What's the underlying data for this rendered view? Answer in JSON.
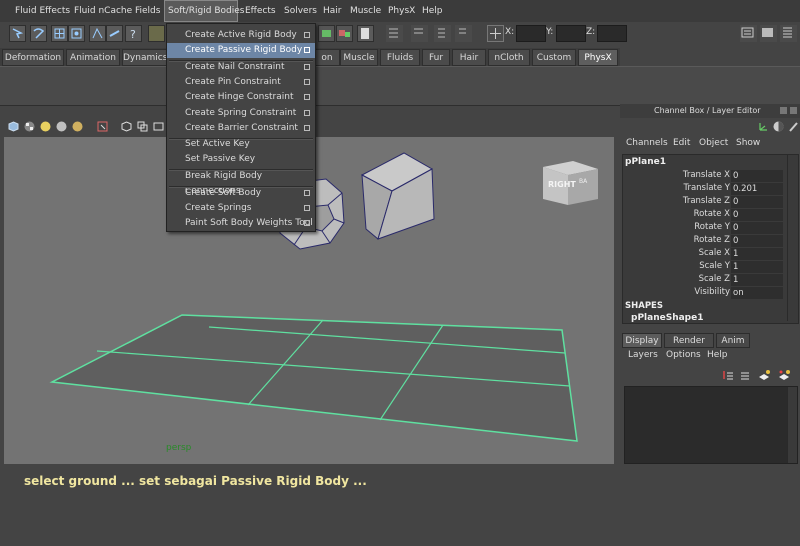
{
  "menubar": {
    "items": [
      "Fluid Effects",
      "Fluid nCache",
      "Fields",
      "Soft/Rigid Bodies",
      "Effects",
      "Solvers",
      "Hair",
      "Muscle",
      "PhysX",
      "Help"
    ]
  },
  "toolbar": {
    "x_label": "X:",
    "y_label": "Y:",
    "z_label": "Z:"
  },
  "shelf": {
    "tabs": [
      "Deformation",
      "Animation",
      "Dynamics",
      "",
      "on",
      "Muscle",
      "Fluids",
      "Fur",
      "Hair",
      "nCloth",
      "Custom",
      "PhysX"
    ],
    "selected": "PhysX"
  },
  "dropdown": {
    "items": [
      {
        "label": "Create Active Rigid Body",
        "option": true
      },
      {
        "label": "Create Passive Rigid Body",
        "option": true,
        "highlighted": true
      },
      {
        "label": "Create Nail Constraint",
        "option": true
      },
      {
        "label": "Create Pin Constraint",
        "option": true
      },
      {
        "label": "Create Hinge Constraint",
        "option": true
      },
      {
        "label": "Create Spring Constraint",
        "option": true
      },
      {
        "label": "Create Barrier Constraint",
        "option": true
      },
      {
        "label": "Set Active Key",
        "option": false
      },
      {
        "label": "Set Passive Key",
        "option": false
      },
      {
        "label": "Break Rigid Body Connections",
        "option": false
      },
      {
        "label": "Create Soft Body",
        "option": true
      },
      {
        "label": "Create Springs",
        "option": true
      },
      {
        "label": "Paint Soft Body Weights Tool",
        "option": true
      }
    ]
  },
  "viewport": {
    "camera_label": "persp",
    "viewcube_face_front": "RIGHT",
    "viewcube_face_side": "BA",
    "ground_edge_color": "#5fe0a0"
  },
  "channel_box": {
    "title": "Channel Box / Layer Editor",
    "menu": [
      "Channels",
      "Edit",
      "Object",
      "Show"
    ],
    "object_name": "pPlane1",
    "attributes": [
      {
        "name": "Translate X",
        "value": "0"
      },
      {
        "name": "Translate Y",
        "value": "0.201"
      },
      {
        "name": "Translate Z",
        "value": "0"
      },
      {
        "name": "Rotate X",
        "value": "0"
      },
      {
        "name": "Rotate Y",
        "value": "0"
      },
      {
        "name": "Rotate Z",
        "value": "0"
      },
      {
        "name": "Scale X",
        "value": "1"
      },
      {
        "name": "Scale Y",
        "value": "1"
      },
      {
        "name": "Scale Z",
        "value": "1"
      },
      {
        "name": "Visibility",
        "value": "on"
      }
    ],
    "shapes_label": "SHAPES",
    "shape_name": "pPlaneShape1"
  },
  "layer_editor": {
    "tabs": [
      "Display",
      "Render",
      "Anim"
    ],
    "selected_tab": "Display",
    "menu": [
      "Layers",
      "Options",
      "Help"
    ]
  },
  "caption": "select ground ... set sebagai Passive Rigid Body ..."
}
